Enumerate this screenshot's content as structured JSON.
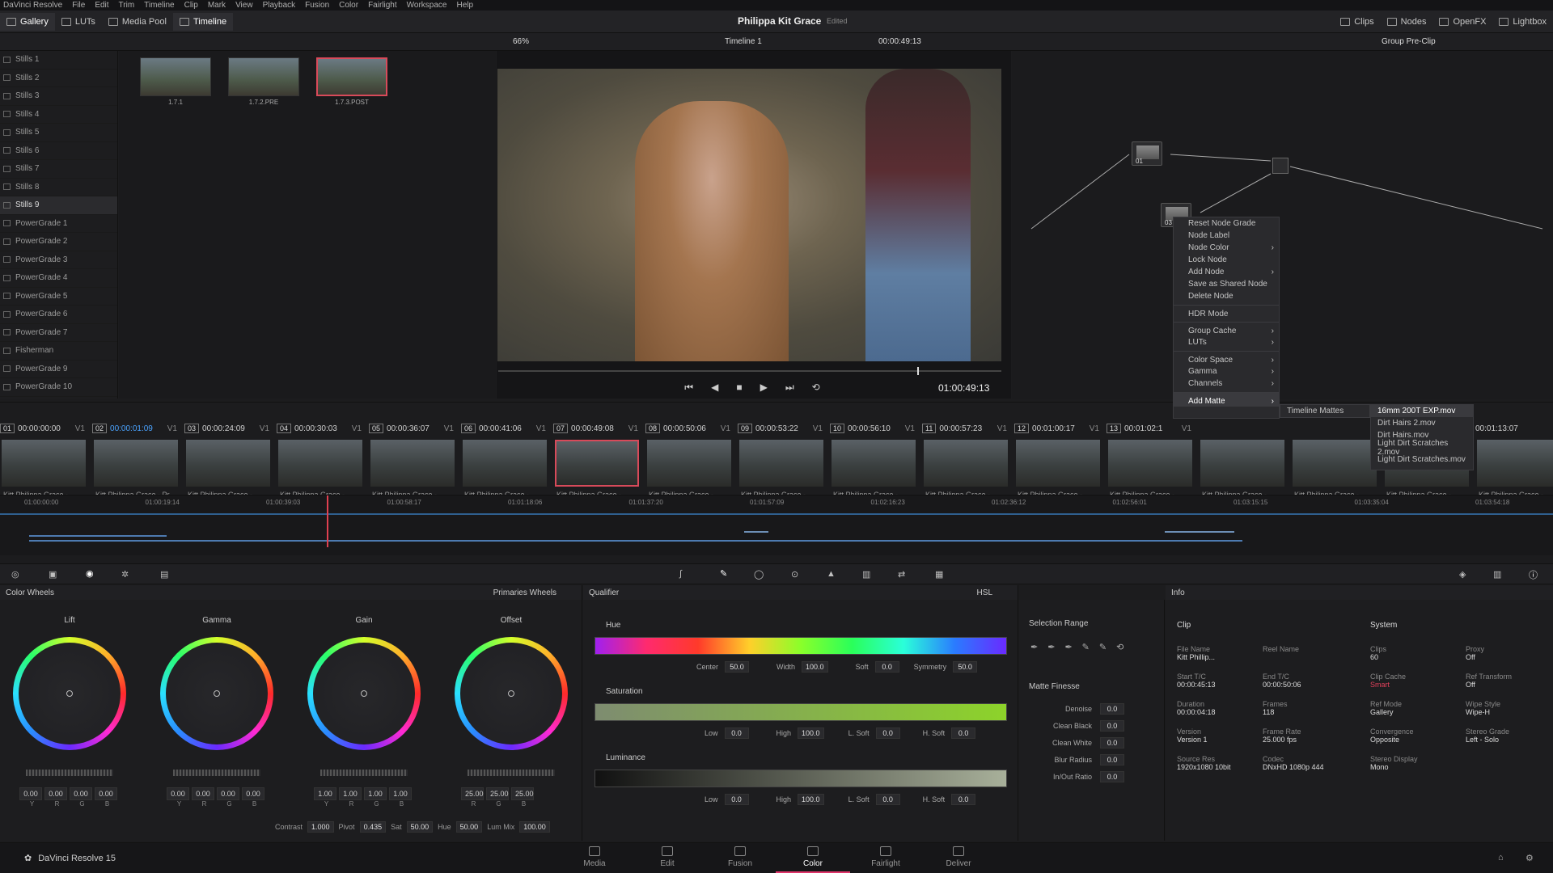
{
  "menu": [
    "DaVinci Resolve",
    "File",
    "Edit",
    "Trim",
    "Timeline",
    "Clip",
    "Mark",
    "View",
    "Playback",
    "Fusion",
    "Color",
    "Fairlight",
    "Workspace",
    "Help"
  ],
  "toolbar": {
    "gallery": "Gallery",
    "luts": "LUTs",
    "media_pool": "Media Pool",
    "timeline": "Timeline",
    "project": "Philippa Kit Grace",
    "edited": "Edited",
    "clips": "Clips",
    "nodes": "Nodes",
    "openfx": "OpenFX",
    "lightbox": "Lightbox"
  },
  "viewer": {
    "zoom": "66%",
    "timeline": "Timeline 1",
    "tc": "00:00:49:13",
    "mode": "Group Pre-Clip",
    "tc_big": "01:00:49:13"
  },
  "gallery": [
    "Stills 1",
    "Stills 2",
    "Stills 3",
    "Stills 4",
    "Stills 5",
    "Stills 6",
    "Stills 7",
    "Stills 8",
    "Stills 9",
    "PowerGrade 1",
    "PowerGrade 2",
    "PowerGrade 3",
    "PowerGrade 4",
    "PowerGrade 5",
    "PowerGrade 6",
    "PowerGrade 7",
    "Fisherman",
    "PowerGrade 9",
    "PowerGrade 10"
  ],
  "stills": [
    "1.7.1",
    "1.7.2.PRE",
    "1.7.3.POST"
  ],
  "context_menu": [
    "Reset Node Grade",
    "Node Label",
    "Node Color",
    "Lock Node",
    "Add Node",
    "Save as Shared Node",
    "Delete Node",
    "HDR Mode",
    "Group Cache",
    "LUTs",
    "Color Space",
    "Gamma",
    "Channels",
    "Add Matte"
  ],
  "submenu": "Timeline Mattes",
  "mattes": [
    "16mm 200T EXP.mov",
    "Dirt Hairs 2.mov",
    "Dirt Hairs.mov",
    "Light Dirt Scratches 2.mov",
    "Light Dirt Scratches.mov"
  ],
  "nodes": {
    "n1": "01",
    "n2": "03"
  },
  "clips": [
    {
      "n": "01",
      "tc": "00:00:00:00",
      "name": "Kitt Philippa Grace - ..."
    },
    {
      "n": "02",
      "tc": "00:00:01:09",
      "name": "Kitt Philippa Grace - Pr..."
    },
    {
      "n": "03",
      "tc": "00:00:24:09",
      "name": "Kitt Philippa Grace - ..."
    },
    {
      "n": "04",
      "tc": "00:00:30:03",
      "name": "Kitt Philippa Grace - ..."
    },
    {
      "n": "05",
      "tc": "00:00:36:07",
      "name": "Kitt Philippa Grace - ..."
    },
    {
      "n": "06",
      "tc": "00:00:41:06",
      "name": "Kitt Philippa Grace - ..."
    },
    {
      "n": "07",
      "tc": "00:00:49:08",
      "name": "Kitt Philippa Grace - ..."
    },
    {
      "n": "08",
      "tc": "00:00:50:06",
      "name": "Kitt Philippa Grace - ..."
    },
    {
      "n": "09",
      "tc": "00:00:53:22",
      "name": "Kitt Philippa Grace - ..."
    },
    {
      "n": "10",
      "tc": "00:00:56:10",
      "name": "Kitt Philippa Grace - ..."
    },
    {
      "n": "11",
      "tc": "00:00:57:23",
      "name": "Kitt Philippa Grace - ..."
    },
    {
      "n": "12",
      "tc": "00:01:00:17",
      "name": "Kitt Philippa Grace - ..."
    },
    {
      "n": "13",
      "tc": "00:01:02:1",
      "name": "Kitt Philippa Grace - ..."
    },
    {
      "n": "",
      "tc": "",
      "name": "Kitt Philippa Grace - ..."
    },
    {
      "n": "",
      "tc": "",
      "name": "Kitt Philippa Grace - ..."
    },
    {
      "n": "",
      "tc": "",
      "name": "Kitt Philippa Grace - ..."
    },
    {
      "n": "",
      "tc": "00:01:13:07",
      "name": "Kitt Philippa Grace - ..."
    }
  ],
  "ruler": [
    "01:00:00:00",
    "01:00:19:14",
    "01:00:39:03",
    "01:00:58:17",
    "01:01:18:06",
    "01:01:37:20",
    "01:01:57:09",
    "01:02:16:23",
    "01:02:36:12",
    "01:02:56:01",
    "01:03:15:15",
    "01:03:35:04",
    "01:03:54:18"
  ],
  "wheels": {
    "title": "Color Wheels",
    "mode": "Primaries Wheels",
    "items": [
      {
        "name": "Lift",
        "vals": [
          "0.00",
          "0.00",
          "0.00",
          "0.00"
        ]
      },
      {
        "name": "Gamma",
        "vals": [
          "0.00",
          "0.00",
          "0.00",
          "0.00"
        ]
      },
      {
        "name": "Gain",
        "vals": [
          "1.00",
          "1.00",
          "1.00",
          "1.00"
        ]
      },
      {
        "name": "Offset",
        "vals": [
          "25.00",
          "25.00",
          "25.00"
        ]
      }
    ],
    "footer": {
      "contrast_l": "Contrast",
      "contrast": "1.000",
      "pivot_l": "Pivot",
      "pivot": "0.435",
      "sat_l": "Sat",
      "sat": "50.00",
      "hue_l": "Hue",
      "hue": "50.00",
      "lummix_l": "Lum Mix",
      "lummix": "100.00"
    }
  },
  "qualifier": {
    "title": "Qualifier",
    "mode": "HSL",
    "hue": "Hue",
    "sat": "Saturation",
    "lum": "Luminance",
    "center_l": "Center",
    "center": "50.0",
    "width_l": "Width",
    "width": "100.0",
    "soft_l": "Soft",
    "soft": "0.0",
    "sym_l": "Symmetry",
    "sym": "50.0",
    "low_l": "Low",
    "low": "0.0",
    "high_l": "High",
    "high": "100.0",
    "lsoft_l": "L. Soft",
    "lsoft": "0.0",
    "hsoft_l": "H. Soft",
    "hsoft": "0.0"
  },
  "selection": {
    "title": "Selection Range",
    "matte": "Matte Finesse",
    "rows": [
      [
        "Denoise",
        "0.0"
      ],
      [
        "Clean Black",
        "0.0"
      ],
      [
        "Clean White",
        "0.0"
      ],
      [
        "Blur Radius",
        "0.0"
      ],
      [
        "In/Out Ratio",
        "0.0"
      ]
    ]
  },
  "info": {
    "title": "Info",
    "clip": "Clip",
    "system": "System",
    "fields": [
      [
        "File Name",
        "Kitt Phillip..."
      ],
      [
        "Reel Name",
        ""
      ],
      [
        "Start T/C",
        "00:00:45:13"
      ],
      [
        "End T/C",
        "00:00:50:06"
      ],
      [
        "Duration",
        "00:00:04:18"
      ],
      [
        "Frames",
        "118"
      ],
      [
        "Version",
        "Version 1"
      ],
      [
        "Frame Rate",
        "25.000 fps"
      ],
      [
        "Source Res",
        "1920x1080 10bit"
      ],
      [
        "Codec",
        "DNxHD 1080p 444"
      ]
    ],
    "sys": [
      [
        "Clips",
        "60"
      ],
      [
        "Proxy",
        "Off"
      ],
      [
        "Clip Cache",
        "Smart"
      ],
      [
        "Ref Transform",
        "Off"
      ],
      [
        "Ref Mode",
        "Gallery"
      ],
      [
        "Wipe Style",
        "Wipe-H"
      ],
      [
        "Convergence",
        "Opposite"
      ],
      [
        "Stereo Grade",
        "Left - Solo"
      ],
      [
        "Stereo Display",
        "Mono"
      ]
    ]
  },
  "pages": [
    "Media",
    "Edit",
    "Fusion",
    "Color",
    "Fairlight",
    "Deliver"
  ],
  "brand": "DaVinci Resolve 15"
}
